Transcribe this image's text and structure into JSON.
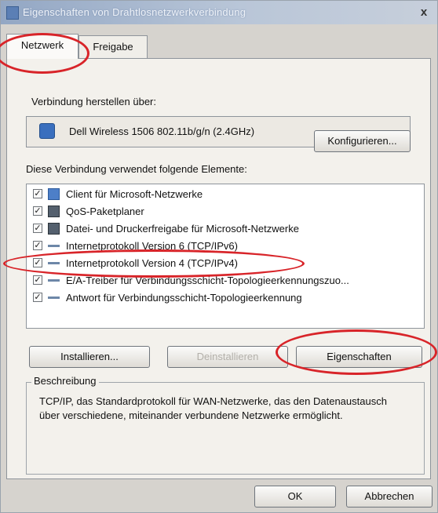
{
  "window": {
    "title": "Eigenschaften von Drahtlosnetzwerkverbindung",
    "close_label": "x"
  },
  "tabs": [
    {
      "label": "Netzwerk",
      "selected": true
    },
    {
      "label": "Freigabe",
      "selected": false
    }
  ],
  "connection": {
    "connect_using_label": "Verbindung herstellen über:",
    "adapter_name": "Dell Wireless 1506 802.11b/g/n (2.4GHz)",
    "configure_button": "Konfigurieren..."
  },
  "elements": {
    "heading": "Diese Verbindung verwendet folgende Elemente:",
    "items": [
      {
        "label": "Client für Microsoft-Netzwerke",
        "checked": true,
        "icon": "network-client-icon"
      },
      {
        "label": "QoS-Paketplaner",
        "checked": true,
        "icon": "network-service-icon"
      },
      {
        "label": "Datei- und Druckerfreigabe für Microsoft-Netzwerke",
        "checked": true,
        "icon": "network-service-icon"
      },
      {
        "label": "Internetprotokoll Version 6 (TCP/IPv6)",
        "checked": true,
        "icon": "network-protocol-icon"
      },
      {
        "label": "Internetprotokoll Version 4 (TCP/IPv4)",
        "checked": true,
        "icon": "network-protocol-icon"
      },
      {
        "label": "E/A-Treiber für Verbindungsschicht-Topologieerkennungszuo...",
        "checked": true,
        "icon": "network-protocol-icon"
      },
      {
        "label": "Antwort für Verbindungsschicht-Topologieerkennung",
        "checked": true,
        "icon": "network-protocol-icon"
      }
    ]
  },
  "actions": {
    "install_button": "Installieren...",
    "uninstall_button": "Deinstallieren",
    "properties_button": "Eigenschaften"
  },
  "description": {
    "legend": "Beschreibung",
    "text": "TCP/IP, das Standardprotokoll für WAN-Netzwerke, das den Datenaustausch über verschiedene, miteinander verbundene Netzwerke ermöglicht."
  },
  "footer": {
    "ok_button": "OK",
    "cancel_button": "Abbrechen"
  },
  "colors": {
    "annotation_red": "#d82429",
    "titlebar": "#93a7c4",
    "dialog_bg": "#d6d3ce"
  }
}
